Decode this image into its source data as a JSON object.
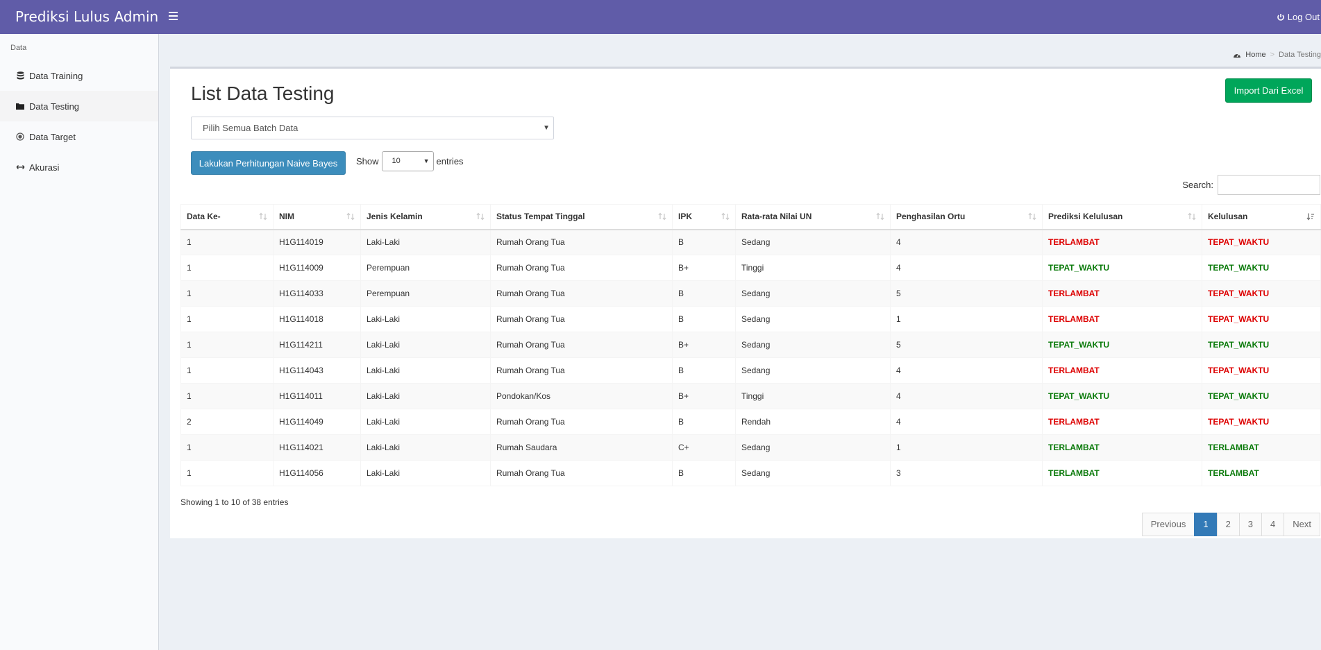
{
  "header": {
    "brand": "Prediksi Lulus Admin",
    "logout": "Log Out"
  },
  "sidebar": {
    "section": "Data",
    "items": [
      {
        "label": "Data Training",
        "icon": "database-icon"
      },
      {
        "label": "Data Testing",
        "icon": "folder-icon"
      },
      {
        "label": "Data Target",
        "icon": "target-icon"
      },
      {
        "label": "Akurasi",
        "icon": "arrows-h-icon"
      }
    ]
  },
  "breadcrumb": {
    "home": "Home",
    "current": "Data Testing"
  },
  "main": {
    "title": "List Data Testing",
    "import_button": "Import Dari Excel",
    "batch_select": "Pilih Semua Batch Data",
    "calc_button": "Lakukan Perhitungan Naive Bayes",
    "show_label": "Show",
    "show_value": "10",
    "entries_label": "entries",
    "search_label": "Search:",
    "search_value": ""
  },
  "table": {
    "columns": [
      "Data Ke-",
      "NIM",
      "Jenis Kelamin",
      "Status Tempat Tinggal",
      "IPK",
      "Rata-rata Nilai UN",
      "Penghasilan Ortu",
      "Prediksi Kelulusan",
      "Kelulusan"
    ],
    "rows": [
      [
        "1",
        "H1G114019",
        "Laki-Laki",
        "Rumah Orang Tua",
        "B",
        "Sedang",
        "4",
        "TERLAMBAT",
        "TEPAT_WAKTU"
      ],
      [
        "1",
        "H1G114009",
        "Perempuan",
        "Rumah Orang Tua",
        "B+",
        "Tinggi",
        "4",
        "TEPAT_WAKTU",
        "TEPAT_WAKTU"
      ],
      [
        "1",
        "H1G114033",
        "Perempuan",
        "Rumah Orang Tua",
        "B",
        "Sedang",
        "5",
        "TERLAMBAT",
        "TEPAT_WAKTU"
      ],
      [
        "1",
        "H1G114018",
        "Laki-Laki",
        "Rumah Orang Tua",
        "B",
        "Sedang",
        "1",
        "TERLAMBAT",
        "TEPAT_WAKTU"
      ],
      [
        "1",
        "H1G114211",
        "Laki-Laki",
        "Rumah Orang Tua",
        "B+",
        "Sedang",
        "5",
        "TEPAT_WAKTU",
        "TEPAT_WAKTU"
      ],
      [
        "1",
        "H1G114043",
        "Laki-Laki",
        "Rumah Orang Tua",
        "B",
        "Sedang",
        "4",
        "TERLAMBAT",
        "TEPAT_WAKTU"
      ],
      [
        "1",
        "H1G114011",
        "Laki-Laki",
        "Pondokan/Kos",
        "B+",
        "Tinggi",
        "4",
        "TEPAT_WAKTU",
        "TEPAT_WAKTU"
      ],
      [
        "2",
        "H1G114049",
        "Laki-Laki",
        "Rumah Orang Tua",
        "B",
        "Rendah",
        "4",
        "TERLAMBAT",
        "TEPAT_WAKTU"
      ],
      [
        "1",
        "H1G114021",
        "Laki-Laki",
        "Rumah Saudara",
        "C+",
        "Sedang",
        "1",
        "TERLAMBAT",
        "TERLAMBAT"
      ],
      [
        "1",
        "H1G114056",
        "Laki-Laki",
        "Rumah Orang Tua",
        "B",
        "Sedang",
        "3",
        "TERLAMBAT",
        "TERLAMBAT"
      ]
    ],
    "prediksi_colors": [
      "red",
      "green",
      "red",
      "red",
      "green",
      "red",
      "green",
      "red",
      "green",
      "green"
    ],
    "kelulusan_colors": [
      "red",
      "green",
      "red",
      "red",
      "green",
      "red",
      "green",
      "red",
      "green",
      "green"
    ]
  },
  "footer": {
    "info": "Showing 1 to 10 of 38 entries",
    "pager": {
      "previous": "Previous",
      "pages": [
        "1",
        "2",
        "3",
        "4"
      ],
      "active": "1",
      "next": "Next"
    }
  },
  "colors": {
    "header": "#605ca8",
    "import": "#00a65a",
    "calc": "#3c8dbc",
    "late": "#dd0000",
    "ontime": "#0a7a0a"
  }
}
